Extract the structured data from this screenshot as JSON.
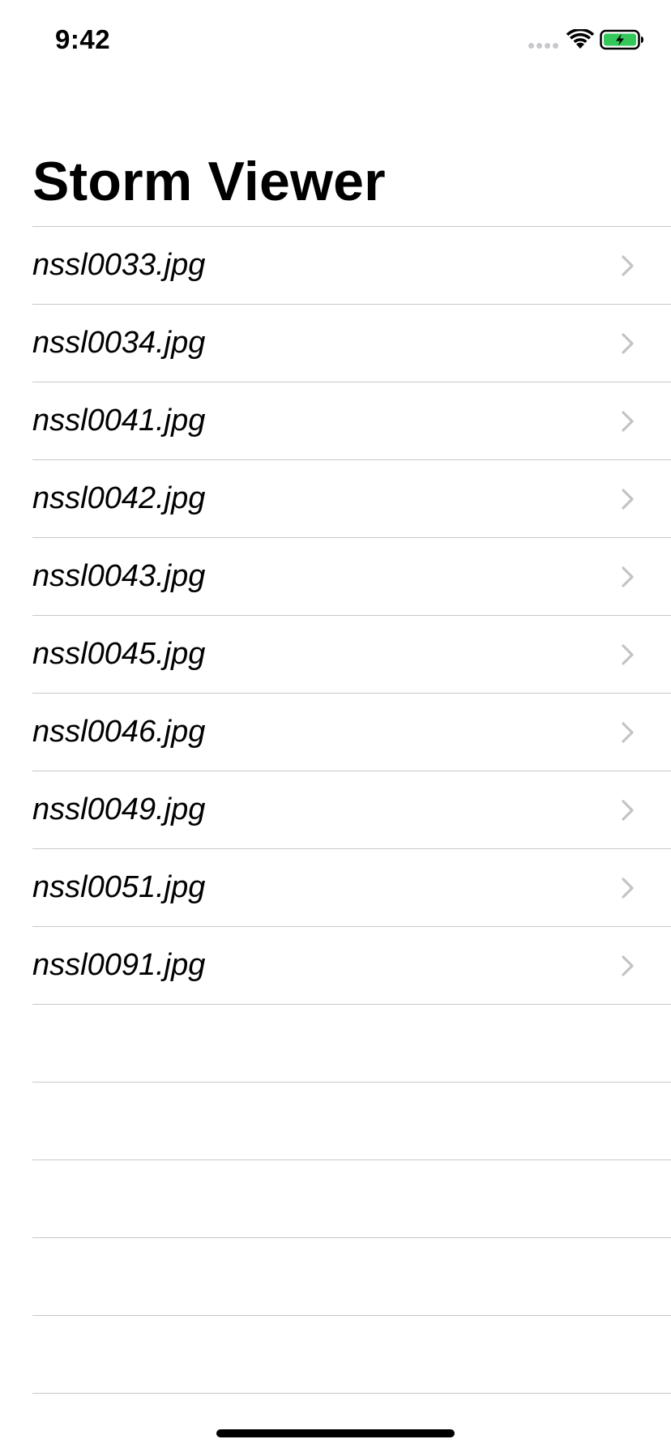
{
  "status_bar": {
    "time": "9:42"
  },
  "navigation": {
    "title": "Storm Viewer"
  },
  "table": {
    "rows": [
      {
        "label": "nssl0033.jpg"
      },
      {
        "label": "nssl0034.jpg"
      },
      {
        "label": "nssl0041.jpg"
      },
      {
        "label": "nssl0042.jpg"
      },
      {
        "label": "nssl0043.jpg"
      },
      {
        "label": "nssl0045.jpg"
      },
      {
        "label": "nssl0046.jpg"
      },
      {
        "label": "nssl0049.jpg"
      },
      {
        "label": "nssl0051.jpg"
      },
      {
        "label": "nssl0091.jpg"
      }
    ],
    "accessory_icon": "chevron-right-icon"
  },
  "colors": {
    "separator": "#c8c7cc",
    "chevron": "#c4c4c7",
    "battery_fill": "#34c759"
  }
}
